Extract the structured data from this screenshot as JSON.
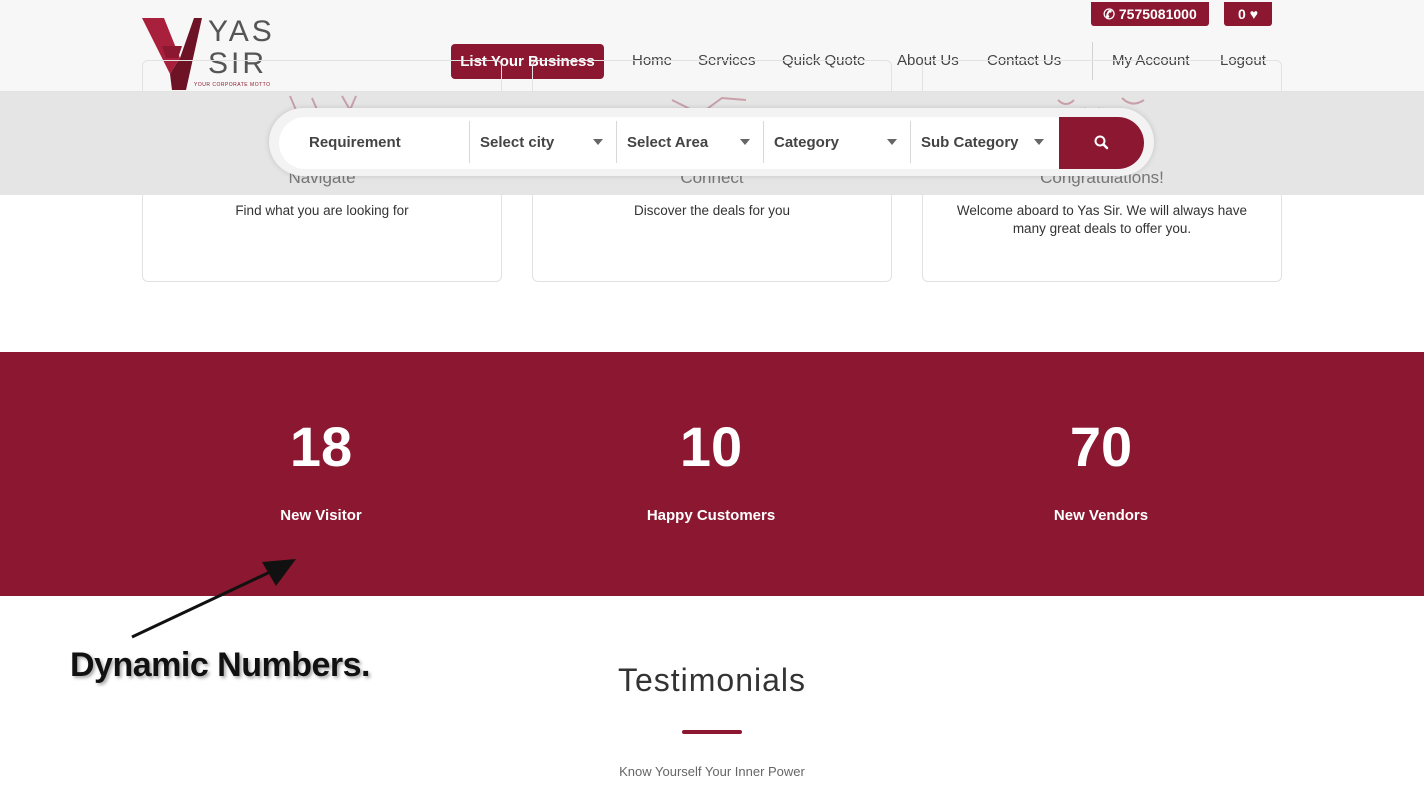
{
  "brand": {
    "name": "YAS SIR",
    "name_line1": "YAS",
    "name_line2": "SIR",
    "motto": "YOUR CORPORATE MOTTO",
    "primary_color": "#8b1730"
  },
  "topbar": {
    "phone": "7575081000",
    "phone_icon": "phone-icon",
    "favorites_count": "0",
    "favorites_icon": "heart-icon"
  },
  "nav": {
    "list_business": "List Your Business",
    "items": [
      "Home",
      "Services",
      "Quick Quote",
      "About Us",
      "Contact Us"
    ],
    "account": "My Account",
    "logout": "Logout"
  },
  "search": {
    "requirement": "Requirement",
    "city": "Select city",
    "area": "Select Area",
    "category": "Category",
    "sub_category": "Sub Category",
    "button_icon": "search-icon"
  },
  "cards": [
    {
      "title": "Navigate",
      "text": "Find what you are looking for"
    },
    {
      "title": "Connect",
      "text": "Discover the deals for you"
    },
    {
      "title": "Congratulations!",
      "text": "Welcome aboard to Yas Sir. We will always have many great deals to offer you."
    }
  ],
  "stats": [
    {
      "value": "18",
      "label": "New Visitor"
    },
    {
      "value": "10",
      "label": "Happy Customers"
    },
    {
      "value": "70",
      "label": "New Vendors"
    }
  ],
  "annotation": {
    "text": "Dynamic Numbers."
  },
  "testimonials": {
    "title": "Testimonials",
    "subtitle": "Know Yourself Your Inner Power"
  }
}
